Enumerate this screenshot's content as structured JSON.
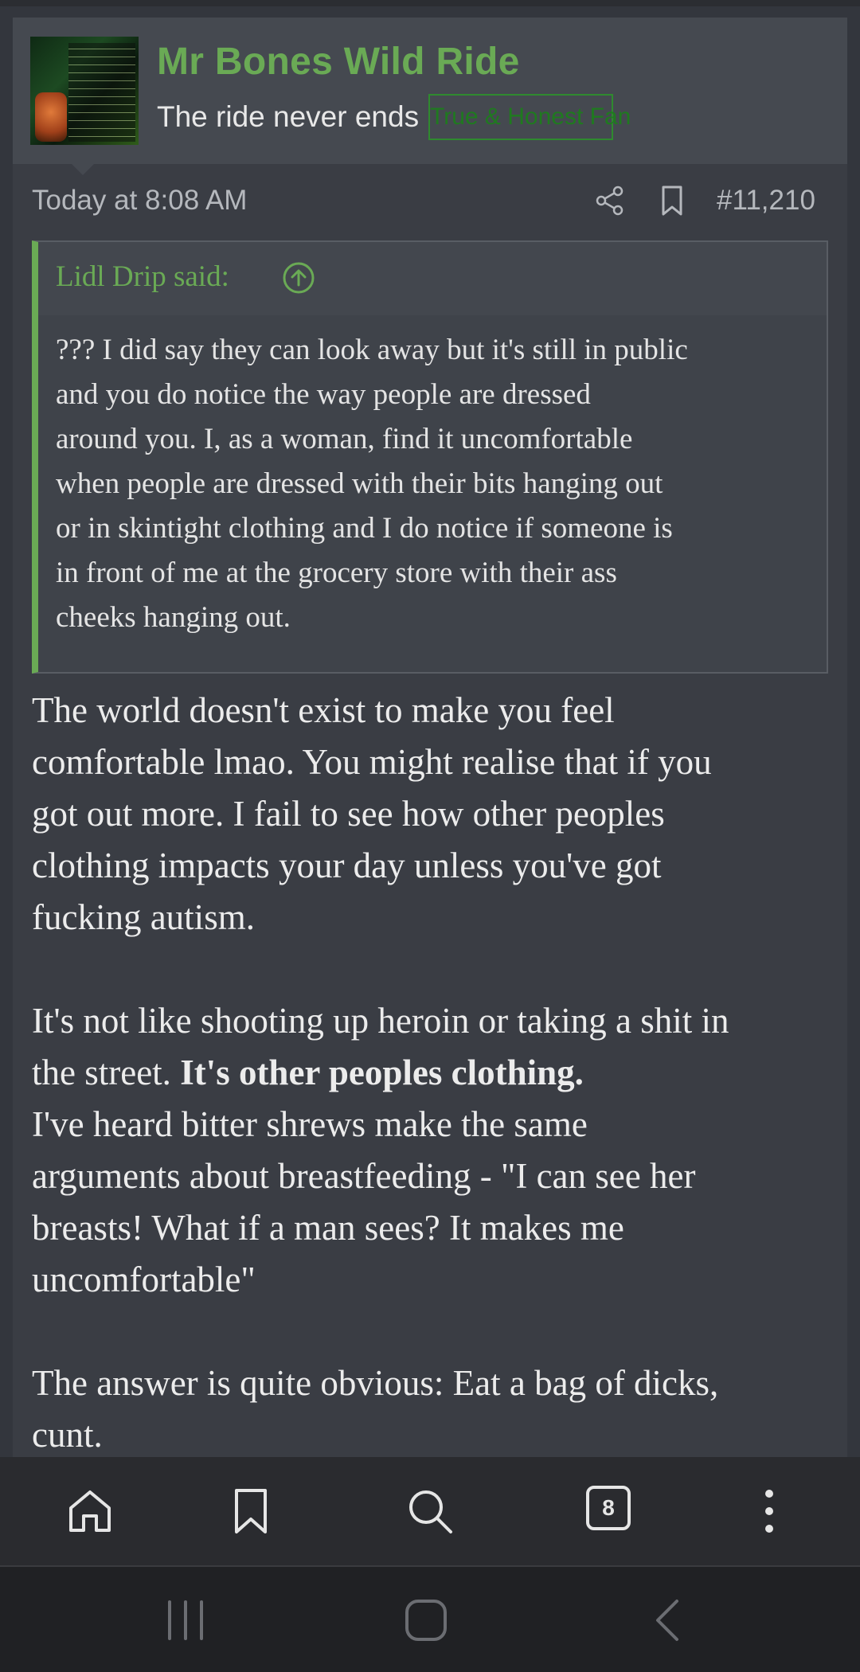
{
  "post": {
    "username": "Mr Bones Wild Ride",
    "user_title": "The ride never ends",
    "badge": "True & Honest Fan",
    "date": "Today at 8:08 AM",
    "post_number": "#11,210",
    "quote": {
      "author": "Lidl Drip said:",
      "lines": [
        "??? I did say they can look away but it's still in public",
        "and you do notice the way people are dressed",
        "around you. I, as a woman, find it uncomfortable",
        "when people are dressed with their bits hanging out",
        "or in skintight clothing and I do notice if someone is",
        "in front of me at the grocery store with their ass",
        "cheeks hanging out."
      ]
    },
    "body": {
      "p1": [
        "The world doesn't exist to make you feel",
        "comfortable lmao. You might realise that if you",
        "got out more. I fail to see how other peoples",
        "clothing impacts your day unless you've got",
        "fucking autism."
      ],
      "p2_line1": "It's not like shooting up heroin or taking a shit in",
      "p2_line2_plain": "the street. ",
      "p2_line2_bold": "It's other peoples clothing.",
      "p3": [
        "I've heard bitter shrews make the same",
        "arguments about breastfeeding - \"I can see her",
        "breasts! What if a man sees? It makes me",
        "uncomfortable\""
      ],
      "p4": [
        "The answer is quite obvious: Eat a bag of dicks,",
        "cunt."
      ]
    }
  },
  "bottom_nav": {
    "tab_count": "8",
    "icons": [
      "home-icon",
      "bookmark-icon",
      "search-icon",
      "tabs-icon",
      "more-icon"
    ]
  },
  "system_nav": {
    "icons": [
      "recent-apps-icon",
      "home-button-icon",
      "back-icon"
    ]
  },
  "colors": {
    "accent": "#6aaa55",
    "badge_border": "#2f8a2f",
    "background": "#33363d"
  }
}
